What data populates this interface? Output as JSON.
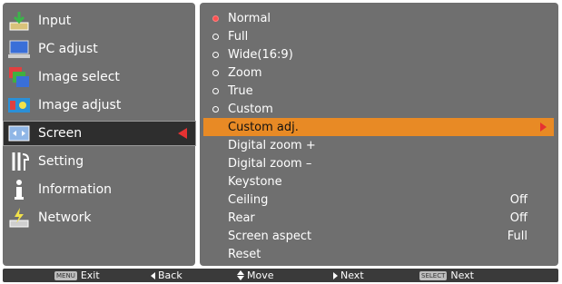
{
  "sidebar": {
    "items": [
      {
        "label": "Input",
        "icon": "input-icon"
      },
      {
        "label": "PC adjust",
        "icon": "pc-adjust-icon"
      },
      {
        "label": "Image select",
        "icon": "image-select-icon"
      },
      {
        "label": "Image adjust",
        "icon": "image-adjust-icon"
      },
      {
        "label": "Screen",
        "icon": "screen-icon",
        "selected": true
      },
      {
        "label": "Setting",
        "icon": "setting-icon"
      },
      {
        "label": "Information",
        "icon": "information-icon"
      },
      {
        "label": "Network",
        "icon": "network-icon"
      }
    ]
  },
  "options": {
    "radio": [
      {
        "label": "Normal",
        "selected": true
      },
      {
        "label": "Full"
      },
      {
        "label": "Wide(16:9)"
      },
      {
        "label": "Zoom"
      },
      {
        "label": "True"
      },
      {
        "label": "Custom"
      }
    ],
    "items": [
      {
        "label": "Custom adj.",
        "highlighted": true
      },
      {
        "label": "Digital zoom +"
      },
      {
        "label": "Digital zoom –"
      },
      {
        "label": "Keystone"
      },
      {
        "label": "Ceiling",
        "value": "Off"
      },
      {
        "label": "Rear",
        "value": "Off"
      },
      {
        "label": "Screen aspect",
        "value": "Full"
      },
      {
        "label": "Reset"
      }
    ]
  },
  "footer": {
    "menu_key": "MENU",
    "exit": "Exit",
    "back": "Back",
    "move": "Move",
    "next": "Next",
    "select_key": "SELECT",
    "select_next": "Next"
  },
  "colors": {
    "panel": "#6f6f6f",
    "highlight": "#e88a25",
    "selected_bg": "#2e2e2e",
    "accent": "#e63232"
  }
}
